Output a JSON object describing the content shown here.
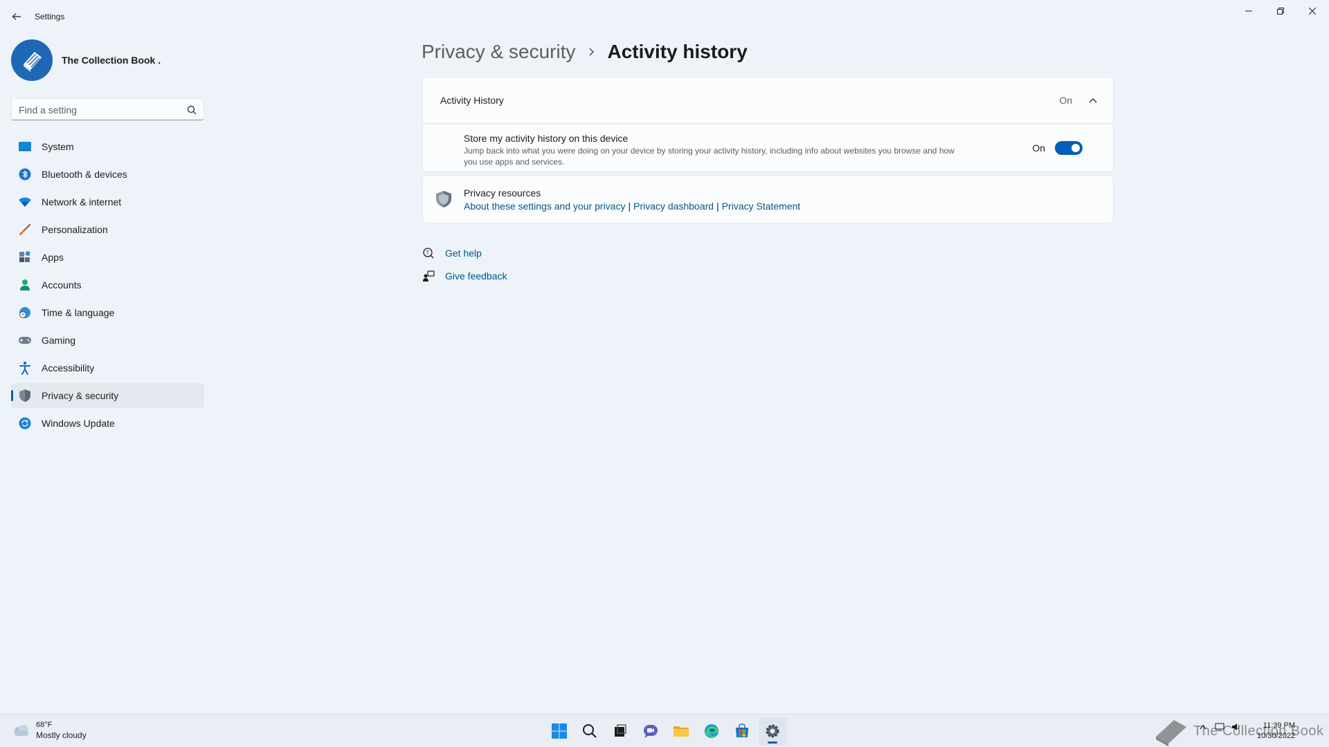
{
  "window": {
    "title": "Settings"
  },
  "profile": {
    "name": "The Collection Book ."
  },
  "search": {
    "placeholder": "Find a setting"
  },
  "sidebar": {
    "items": [
      {
        "label": "System",
        "icon": "monitor-icon"
      },
      {
        "label": "Bluetooth & devices",
        "icon": "bluetooth-icon"
      },
      {
        "label": "Network & internet",
        "icon": "wifi-icon"
      },
      {
        "label": "Personalization",
        "icon": "brush-icon"
      },
      {
        "label": "Apps",
        "icon": "apps-icon"
      },
      {
        "label": "Accounts",
        "icon": "person-icon"
      },
      {
        "label": "Time & language",
        "icon": "globe-clock-icon"
      },
      {
        "label": "Gaming",
        "icon": "gamepad-icon"
      },
      {
        "label": "Accessibility",
        "icon": "accessibility-icon"
      },
      {
        "label": "Privacy & security",
        "icon": "shield-icon",
        "active": true
      },
      {
        "label": "Windows Update",
        "icon": "update-icon"
      }
    ]
  },
  "breadcrumb": {
    "parent": "Privacy & security",
    "current": "Activity history"
  },
  "activity": {
    "header_title": "Activity History",
    "header_state": "On",
    "store_title": "Store my activity history on this device",
    "store_desc": "Jump back into what you were doing on your device by storing your activity history, including info about websites you browse and how you use apps and services.",
    "toggle_state": "On",
    "toggle_on": true
  },
  "resources": {
    "title": "Privacy resources",
    "links": [
      "About these settings and your privacy",
      "Privacy dashboard",
      "Privacy Statement"
    ],
    "separator": "|"
  },
  "help": {
    "get_help": "Get help",
    "give_feedback": "Give feedback"
  },
  "taskbar": {
    "weather_temp": "68°F",
    "weather_desc": "Mostly cloudy",
    "time": "11:39 PM",
    "date": "10/30/2022",
    "watermark": "The Collection Book"
  },
  "colors": {
    "accent": "#005fb8",
    "link": "#00578a",
    "background": "#eef3f9",
    "card": "#fbfcfd"
  }
}
